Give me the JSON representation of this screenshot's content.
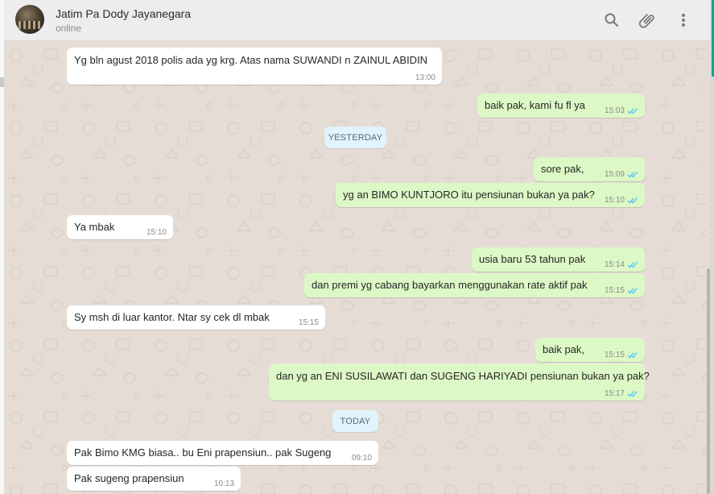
{
  "header": {
    "contact_name": "Jatim Pa Dody Jayanegara",
    "status": "online",
    "icons": [
      "search-icon",
      "attach-icon",
      "menu-icon"
    ]
  },
  "colors": {
    "outgoing_bubble": "#dcf8c6",
    "incoming_bubble": "#ffffff",
    "date_pill": "#e1f3fb",
    "read_ticks": "#4fc3f7",
    "accent": "#0aa58c"
  },
  "messages": [
    {
      "dir": "in",
      "text": "Yg bln agust 2018 polis ada yg krg. Atas nama SUWANDI n ZAINUL ABIDIN",
      "time": "13:00"
    },
    {
      "dir": "out",
      "text": "baik pak, kami fu fl ya",
      "time": "15:03",
      "status": "read"
    },
    {
      "dir": "out",
      "text": "sore pak,",
      "time": "15:09",
      "status": "read"
    },
    {
      "dir": "out",
      "text": "yg an BIMO KUNTJORO itu pensiunan bukan ya pak?",
      "time": "15:10",
      "status": "read"
    },
    {
      "dir": "in",
      "text": "Ya mbak",
      "time": "15:10"
    },
    {
      "dir": "out",
      "text": "usia baru 53 tahun pak",
      "time": "15:14",
      "status": "read"
    },
    {
      "dir": "out",
      "text": "dan premi yg cabang bayarkan menggunakan rate aktif pak",
      "time": "15:15",
      "status": "read"
    },
    {
      "dir": "in",
      "text": "Sy msh di luar kantor. Ntar sy cek dl mbak",
      "time": "15:15"
    },
    {
      "dir": "out",
      "text": "baik pak,",
      "time": "15:15",
      "status": "read"
    },
    {
      "dir": "out",
      "text": "dan yg an ENI SUSILAWATI dan SUGENG HARIYADI pensiunan bukan ya pak?",
      "time": "15:17",
      "status": "read"
    },
    {
      "dir": "in",
      "text": "Pak Bimo KMG biasa.. bu Eni prapensiun.. pak Sugeng",
      "time": "09:10"
    },
    {
      "dir": "in",
      "text": "Pak sugeng prapensiun",
      "time": "10:13"
    }
  ],
  "date_dividers": {
    "yesterday": "YESTERDAY",
    "today": "TODAY"
  }
}
